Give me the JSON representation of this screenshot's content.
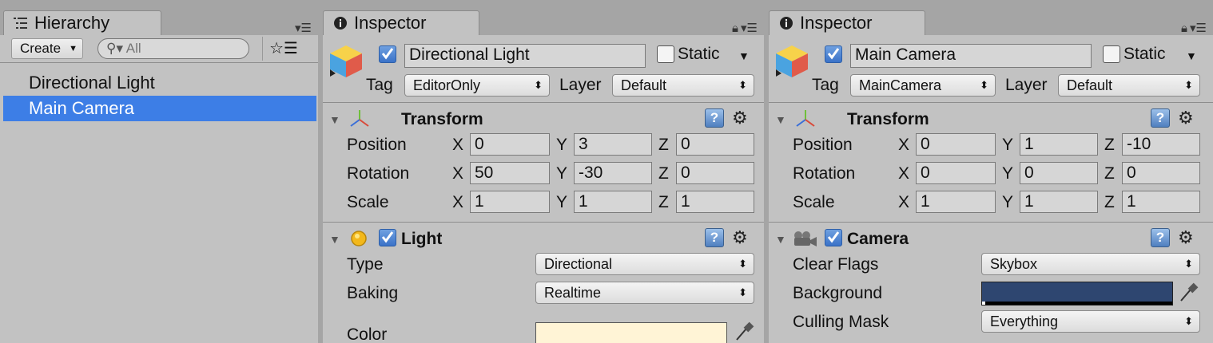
{
  "hierarchy": {
    "tab_label": "Hierarchy",
    "create_label": "Create",
    "search_placeholder": "All",
    "items": [
      {
        "label": "Directional Light",
        "selected": false
      },
      {
        "label": "Main Camera",
        "selected": true
      }
    ]
  },
  "inspectors": [
    {
      "tab_label": "Inspector",
      "object_name": "Directional Light",
      "static_label": "Static",
      "tag_label": "Tag",
      "tag_value": "EditorOnly",
      "layer_label": "Layer",
      "layer_value": "Default",
      "transform": {
        "title": "Transform",
        "rows": [
          {
            "label": "Position",
            "x": "0",
            "y": "3",
            "z": "0"
          },
          {
            "label": "Rotation",
            "x": "50",
            "y": "-30",
            "z": "0"
          },
          {
            "label": "Scale",
            "x": "1",
            "y": "1",
            "z": "1"
          }
        ]
      },
      "component": {
        "title": "Light",
        "icon": "light-bulb-icon",
        "props": [
          {
            "label": "Type",
            "kind": "dropdown",
            "value": "Directional"
          },
          {
            "label": "Baking",
            "kind": "dropdown",
            "value": "Realtime"
          },
          {
            "label": "Color",
            "kind": "color",
            "value": "#fff4d6"
          }
        ]
      }
    },
    {
      "tab_label": "Inspector",
      "object_name": "Main Camera",
      "static_label": "Static",
      "tag_label": "Tag",
      "tag_value": "MainCamera",
      "layer_label": "Layer",
      "layer_value": "Default",
      "transform": {
        "title": "Transform",
        "rows": [
          {
            "label": "Position",
            "x": "0",
            "y": "1",
            "z": "-10"
          },
          {
            "label": "Rotation",
            "x": "0",
            "y": "0",
            "z": "0"
          },
          {
            "label": "Scale",
            "x": "1",
            "y": "1",
            "z": "1"
          }
        ]
      },
      "component": {
        "title": "Camera",
        "icon": "camera-icon",
        "props": [
          {
            "label": "Clear Flags",
            "kind": "dropdown",
            "value": "Skybox"
          },
          {
            "label": "Background",
            "kind": "color",
            "value": "#2e4670"
          },
          {
            "label": "Culling Mask",
            "kind": "dropdown",
            "value": "Everything"
          }
        ]
      }
    }
  ],
  "axis_labels": [
    "X",
    "Y",
    "Z"
  ],
  "colors": {
    "selection": "#3d7ee6",
    "panel": "#c2c2c2",
    "chrome": "#a5a5a5"
  }
}
